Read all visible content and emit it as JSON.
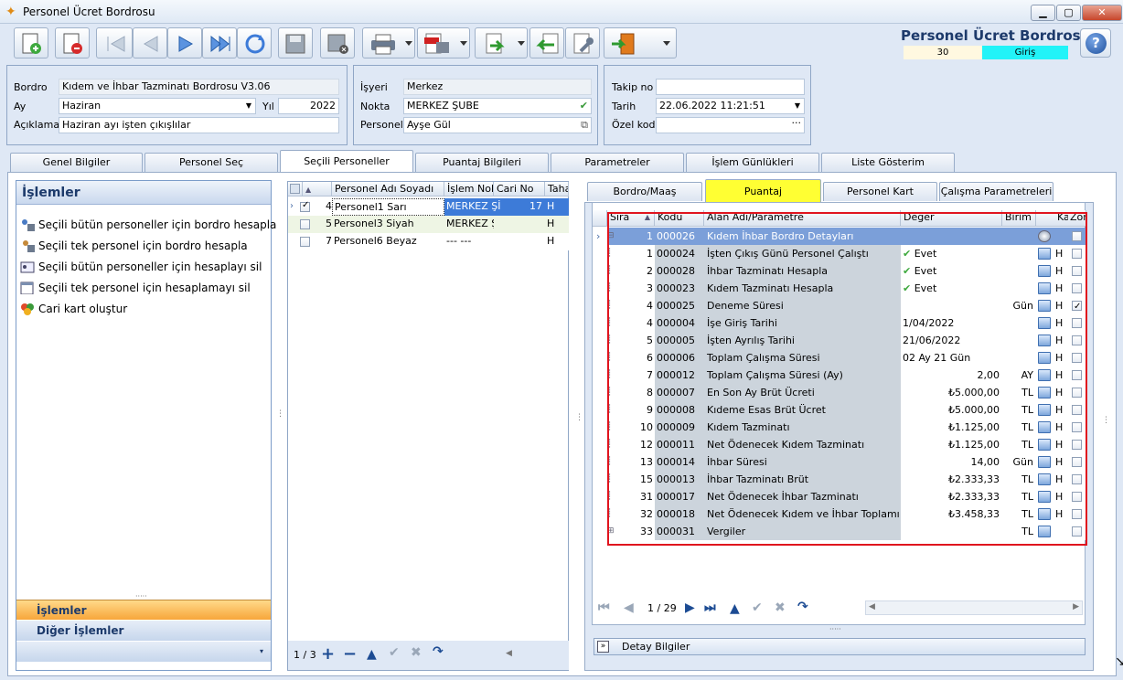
{
  "window": {
    "title": "Personel Ücret Bordrosu",
    "min": "▁",
    "max": "▢",
    "close": "✕"
  },
  "header": {
    "title": "Personel Ücret Bordrosu",
    "number": "30",
    "status": "Giriş",
    "help": "?"
  },
  "form": {
    "bordro_label": "Bordro",
    "bordro_value": "Kıdem ve İhbar Tazminatı Bordrosu V3.06",
    "ay_label": "Ay",
    "ay_value": "Haziran",
    "yil_label": "Yıl",
    "yil_value": "2022",
    "aciklama_label": "Açıklama",
    "aciklama_value": "Haziran ayı işten çıkışlılar",
    "isyeri_label": "İşyeri",
    "isyeri_value": "Merkez",
    "nokta_label": "Nokta",
    "nokta_value": "MERKEZ ŞUBE",
    "personel_label": "Personel",
    "personel_value": "Ayşe Gül",
    "takip_label": "Takip no",
    "takip_value": "",
    "tarih_label": "Tarih",
    "tarih_value": "22.06.2022 11:21:51",
    "ozel_label": "Özel kod",
    "ozel_value": "",
    "ellipsis": "···"
  },
  "tabs": [
    "Genel Bilgiler",
    "Personel Seç",
    "Seçili Personeller",
    "Puantaj Bilgileri",
    "Parametreler",
    "İşlem Günlükleri",
    "Liste Gösterim"
  ],
  "left": {
    "title": "İşlemler",
    "ops": [
      "Seçili bütün personeller için bordro hesapla",
      "Seçili tek personel için bordro hesapla",
      "Seçili bütün personeller için hesaplayı sil",
      "Seçili tek personel için hesaplamayı sil",
      "Cari kart oluştur"
    ],
    "nav_islemler": "İşlemler",
    "nav_diger": "Diğer İşlemler"
  },
  "personel_grid": {
    "headers": [
      "Personel Adı Soyadı",
      "İşlem Nokt",
      "Cari No",
      "Taha"
    ],
    "rows": [
      {
        "no": "4",
        "name": "Personel1 Sarı",
        "nokta": "MERKEZ Şİ",
        "cari": "17",
        "t": "H"
      },
      {
        "no": "5",
        "name": "Personel3 Siyah",
        "nokta": "MERKEZ Şİ",
        "cari": "",
        "t": "H"
      },
      {
        "no": "7",
        "name": "Personel6 Beyaz",
        "nokta": "--- ---",
        "cari": "",
        "t": "H"
      }
    ],
    "pager": "1 / 3"
  },
  "subtabs": [
    "Bordro/Maaş",
    "Puantaj",
    "Personel Kart",
    "Çalışma Parametreleri"
  ],
  "param_grid": {
    "headers": [
      "Sıra",
      "Kodu",
      "Alan Adı/Parametre",
      "Değer",
      "Birim",
      "Ka",
      "Zor"
    ],
    "rows": [
      {
        "sira": "1",
        "kodu": "000026",
        "alan": "Kıdem İhbar Bordro Detayları",
        "deger": "",
        "birim": "",
        "ka": "",
        "group": true
      },
      {
        "sira": "1",
        "kodu": "000024",
        "alan": "İşten Çıkış Günü Personel Çalıştı",
        "deger": "Evet",
        "birim": "",
        "ka": "H",
        "check": true
      },
      {
        "sira": "2",
        "kodu": "000028",
        "alan": "İhbar Tazminatı Hesapla",
        "deger": "Evet",
        "birim": "",
        "ka": "H",
        "check": true
      },
      {
        "sira": "3",
        "kodu": "000023",
        "alan": "Kıdem Tazminatı Hesapla",
        "deger": "Evet",
        "birim": "",
        "ka": "H",
        "check": true
      },
      {
        "sira": "4",
        "kodu": "000025",
        "alan": "Deneme Süresi",
        "deger": "",
        "birim": "Gün",
        "ka": "H",
        "zor": true
      },
      {
        "sira": "4",
        "kodu": "000004",
        "alan": "İşe Giriş Tarihi",
        "deger": "1/04/2022",
        "birim": "",
        "ka": "H"
      },
      {
        "sira": "5",
        "kodu": "000005",
        "alan": "İşten Ayrılış Tarihi",
        "deger": "21/06/2022",
        "birim": "",
        "ka": "H"
      },
      {
        "sira": "6",
        "kodu": "000006",
        "alan": "Toplam Çalışma Süresi",
        "deger": "02 Ay 21 Gün",
        "birim": "",
        "ka": "H"
      },
      {
        "sira": "7",
        "kodu": "000012",
        "alan": "Toplam Çalışma Süresi (Ay)",
        "deger": "2,00",
        "birim": "AY",
        "ka": "H",
        "right": true
      },
      {
        "sira": "8",
        "kodu": "000007",
        "alan": "En Son Ay Brüt Ücreti",
        "deger": "₺5.000,00",
        "birim": "TL",
        "ka": "H",
        "right": true
      },
      {
        "sira": "9",
        "kodu": "000008",
        "alan": "Kıdeme Esas Brüt Ücret",
        "deger": "₺5.000,00",
        "birim": "TL",
        "ka": "H",
        "right": true
      },
      {
        "sira": "10",
        "kodu": "000009",
        "alan": "Kıdem Tazminatı",
        "deger": "₺1.125,00",
        "birim": "TL",
        "ka": "H",
        "right": true
      },
      {
        "sira": "12",
        "kodu": "000011",
        "alan": "Net Ödenecek Kıdem Tazminatı",
        "deger": "₺1.125,00",
        "birim": "TL",
        "ka": "H",
        "right": true
      },
      {
        "sira": "13",
        "kodu": "000014",
        "alan": "İhbar Süresi",
        "deger": "14,00",
        "birim": "Gün",
        "ka": "H",
        "right": true
      },
      {
        "sira": "15",
        "kodu": "000013",
        "alan": "İhbar Tazminatı Brüt",
        "deger": "₺2.333,33",
        "birim": "TL",
        "ka": "H",
        "right": true
      },
      {
        "sira": "31",
        "kodu": "000017",
        "alan": "Net Ödenecek İhbar Tazminatı",
        "deger": "₺2.333,33",
        "birim": "TL",
        "ka": "H",
        "right": true
      },
      {
        "sira": "32",
        "kodu": "000018",
        "alan": "Net Ödenecek Kıdem ve İhbar Toplamı",
        "deger": "₺3.458,33",
        "birim": "TL",
        "ka": "H",
        "right": true
      },
      {
        "sira": "33",
        "kodu": "000031",
        "alan": "Vergiler",
        "deger": "",
        "birim": "TL",
        "ka": "",
        "expand": true
      }
    ],
    "pager": "1 / 29"
  },
  "detay": "Detay Bilgiler",
  "colors": {
    "highlight": "#ffff33",
    "status": "#22f3f8",
    "selected_row": "#3d7bd8",
    "group_row": "#7b9fd9",
    "red_border": "#e0141e"
  }
}
